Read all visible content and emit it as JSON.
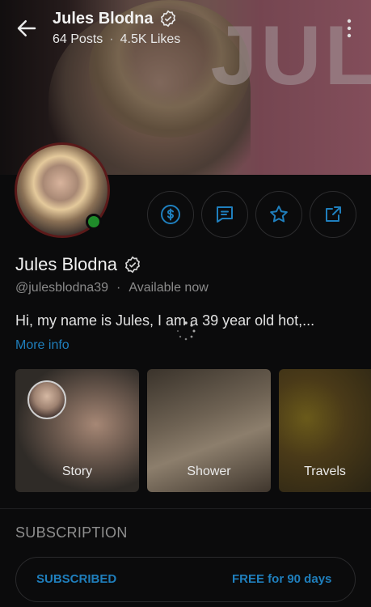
{
  "header": {
    "name": "Jules Blodna",
    "posts": "64 Posts",
    "likes": "4.5K Likes",
    "cover_text": "JUL"
  },
  "profile": {
    "name": "Jules Blodna",
    "handle": "@julesblodna39",
    "status": "Available now",
    "bio": "Hi, my name is Jules, I am a 39 year old hot,...",
    "more_info": "More info"
  },
  "actions": [
    {
      "icon": "dollar-icon"
    },
    {
      "icon": "message-icon"
    },
    {
      "icon": "star-icon"
    },
    {
      "icon": "share-icon"
    }
  ],
  "highlights": [
    {
      "label": "Story"
    },
    {
      "label": "Shower"
    },
    {
      "label": "Travels"
    }
  ],
  "subscription": {
    "heading": "SUBSCRIPTION",
    "status": "SUBSCRIBED",
    "offer": "FREE for 90 days"
  },
  "colors": {
    "accent": "#1f7fbd",
    "online": "#1f8c2a",
    "background": "#0b0b0c"
  }
}
